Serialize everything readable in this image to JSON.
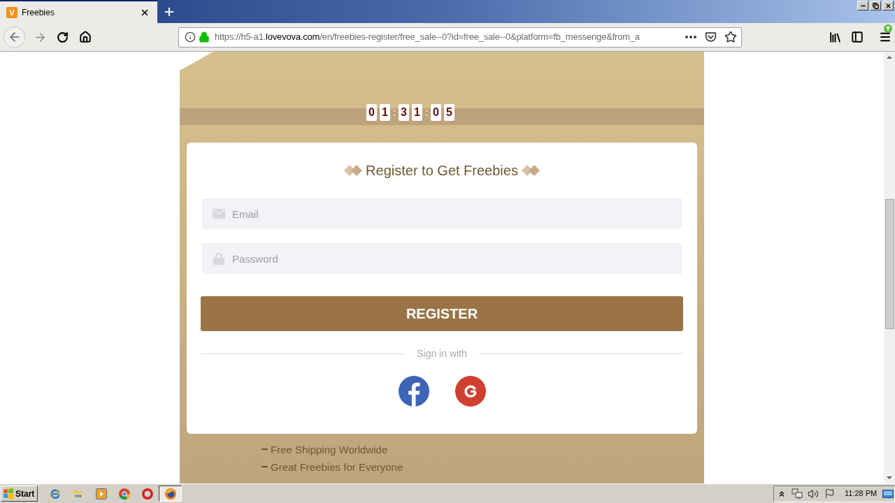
{
  "browser": {
    "tabs": [
      {
        "icon_letter": "V",
        "title": "Freebies",
        "selected": true
      }
    ],
    "url": {
      "before_domain": "https://h5-a1.",
      "domain": "lovevova.com",
      "after_domain": "/en/freebies-register/free_sale--0?id=free_sale--0&platform=fb_messenge&from_a"
    }
  },
  "page": {
    "countdown": [
      {
        "kind": "digit",
        "text": "0"
      },
      {
        "kind": "digit",
        "text": "1"
      },
      {
        "kind": "separator",
        "text": ":"
      },
      {
        "kind": "digit",
        "text": "3"
      },
      {
        "kind": "digit",
        "text": "1"
      },
      {
        "kind": "separator",
        "text": ":"
      },
      {
        "kind": "digit",
        "text": "0"
      },
      {
        "kind": "digit",
        "text": "5"
      }
    ],
    "form": {
      "title": "Register to Get Freebies",
      "fields": [
        {
          "kind": "email",
          "placeholder": "Email"
        },
        {
          "kind": "password",
          "placeholder": "Password"
        }
      ],
      "submit": "REGISTER",
      "divider": "Sign in with",
      "social": [
        {
          "kind": "facebook"
        },
        {
          "kind": "google"
        }
      ]
    },
    "benefits": [
      "Free Shipping Worldwide",
      "Great Freebies for Everyone"
    ]
  },
  "taskbar": {
    "start": "Start",
    "apps": [
      {
        "kind": "ie",
        "active": false
      },
      {
        "kind": "folder",
        "active": false
      },
      {
        "kind": "media",
        "active": false
      },
      {
        "kind": "chrome",
        "active": false
      },
      {
        "kind": "opera",
        "active": false
      },
      {
        "kind": "firefox",
        "active": true
      }
    ],
    "clock": "11:28 PM"
  }
}
